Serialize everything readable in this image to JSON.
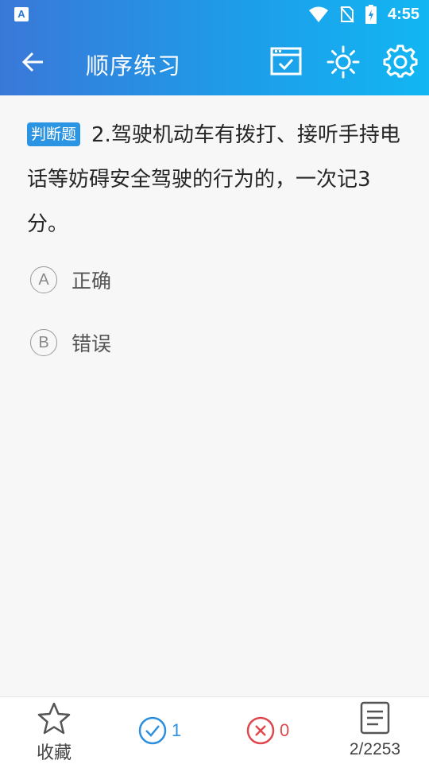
{
  "status_bar": {
    "time": "4:55",
    "notification_icon_letter": "A"
  },
  "app_bar": {
    "title": "顺序练习",
    "icons": [
      "back-arrow-icon",
      "calendar-check-icon",
      "brightness-icon",
      "settings-gear-icon"
    ]
  },
  "question": {
    "type_tag": "判断题",
    "text": "2.驾驶机动车有拨打、接听手持电话等妨碍安全驾驶的行为的，一次记3分。"
  },
  "options": [
    {
      "letter": "A",
      "text": "正确"
    },
    {
      "letter": "B",
      "text": "错误"
    }
  ],
  "bottom_bar": {
    "favorite_label": "收藏",
    "correct_count": "1",
    "wrong_count": "0",
    "progress": "2/2253"
  },
  "colors": {
    "header_start": "#3a78d8",
    "header_end": "#12b6f3",
    "tag_bg": "#2c95e3",
    "correct": "#2d8fe0",
    "wrong": "#e0484f"
  }
}
